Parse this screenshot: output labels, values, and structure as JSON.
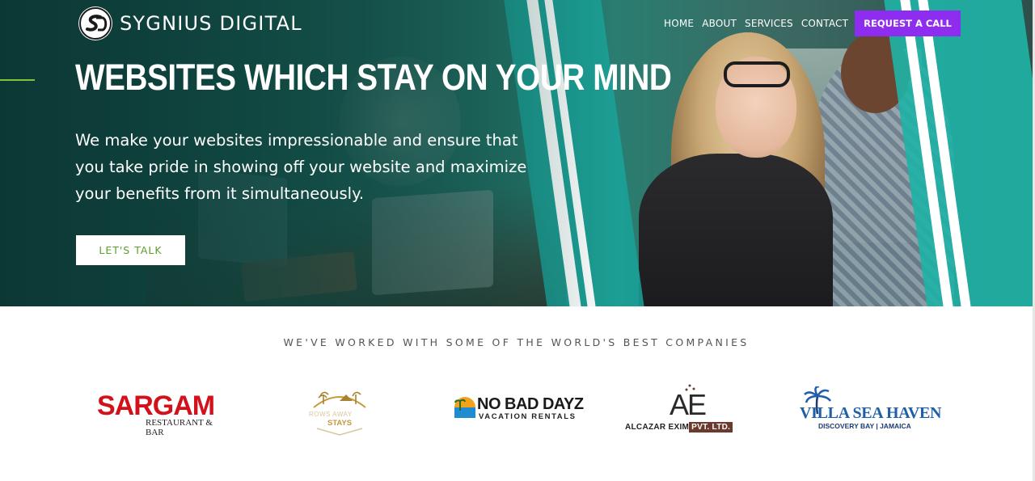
{
  "brand": {
    "name": "SYGNIUS DIGITAL"
  },
  "nav": {
    "links": [
      "HOME",
      "ABOUT",
      "SERVICES",
      "CONTACT"
    ],
    "cta": "REQUEST A CALL"
  },
  "hero": {
    "title": "WEBSITES WHICH STAY ON YOUR MIND",
    "subtitle": "We make your websites impressionable and ensure that you take pride in showing off your website and maximize your benefits from it simultaneously.",
    "button": "LET'S TALK"
  },
  "clients": {
    "heading": "WE'VE WORKED WITH SOME OF THE WORLD'S BEST COMPANIES",
    "logos": [
      {
        "name": "SARGAM",
        "sub": "RESTAURANT & BAR"
      },
      {
        "name": "ROWS AWAY",
        "sub": "STAYS"
      },
      {
        "name": "NO BAD DAYZ",
        "sub": "VACATION RENTALS"
      },
      {
        "mark": "AE",
        "name": "ALCAZAR EXIM",
        "badge": "PVT. LTD."
      },
      {
        "name": "VILLA SEA HAVEN",
        "sub": "DISCOVERY BAY | JAMAICA"
      }
    ]
  },
  "colors": {
    "accent_green": "#7ec43a",
    "cta_purple": "#8e2df0",
    "teal": "#1aa39a",
    "sargam_red": "#d3111a",
    "villa_blue": "#1e5fa8"
  }
}
